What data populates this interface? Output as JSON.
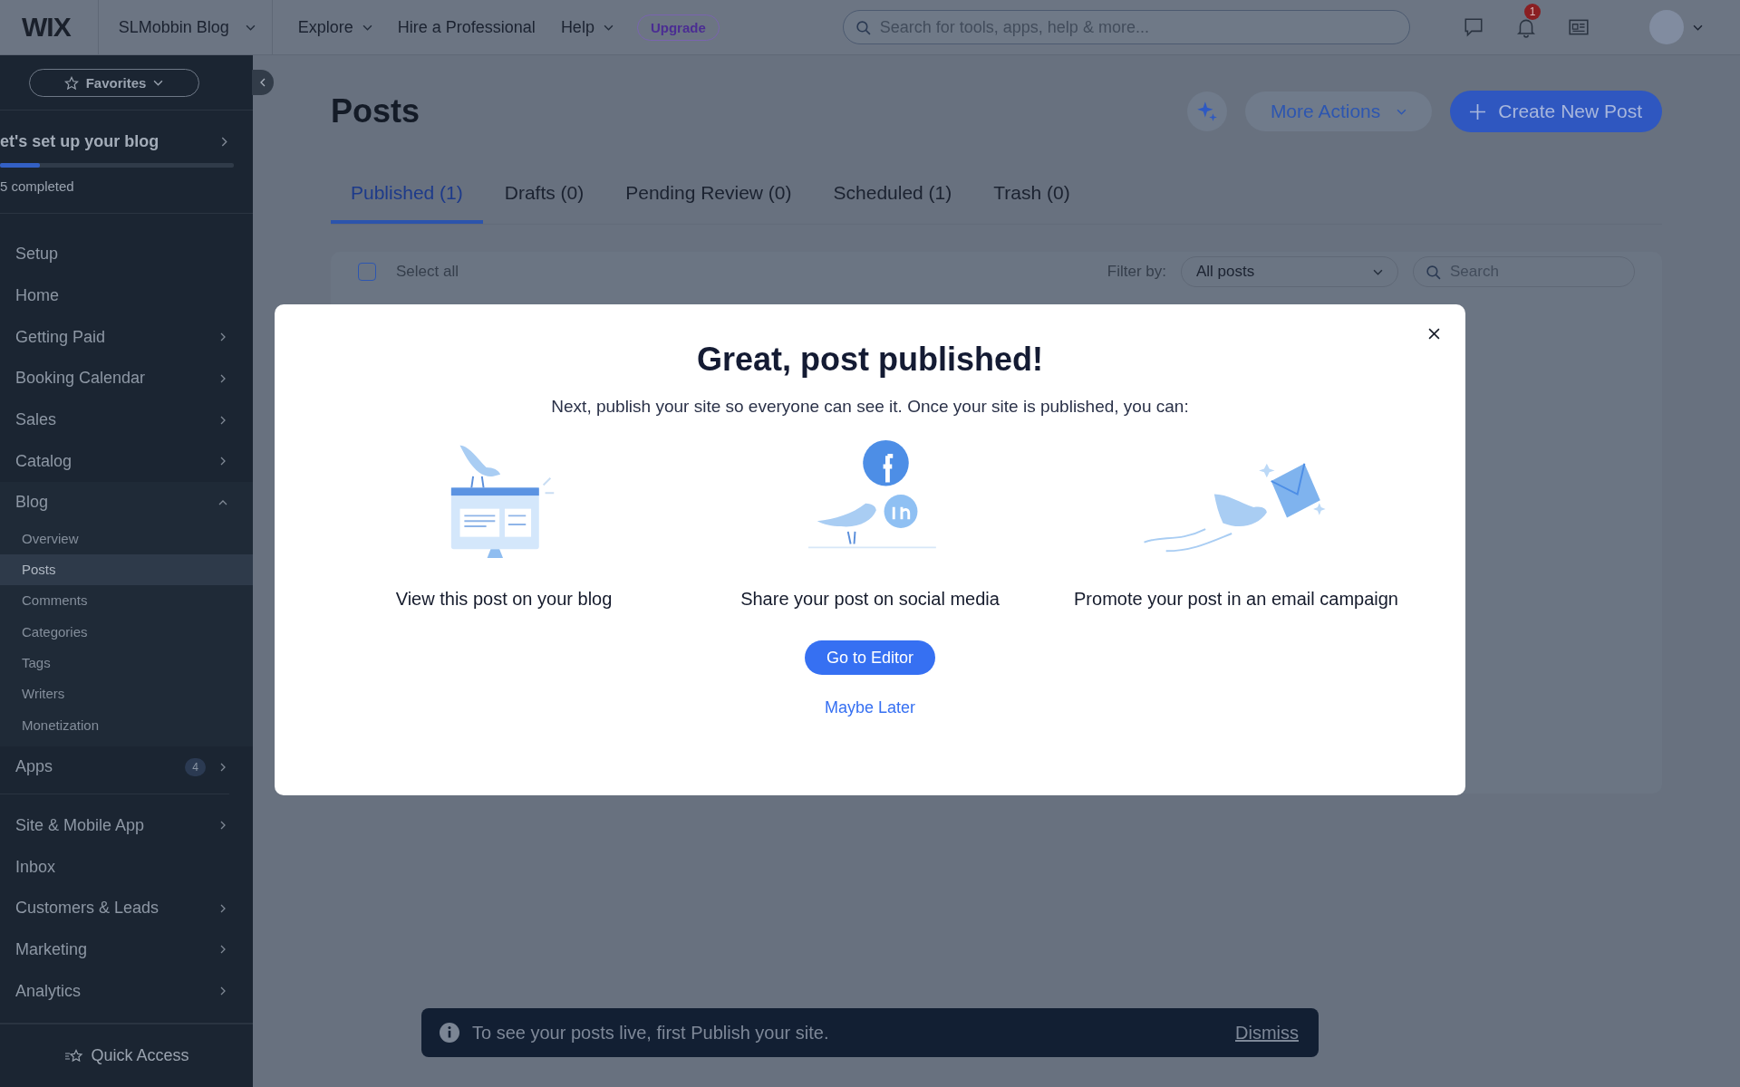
{
  "topbar": {
    "logo": "WIX",
    "site_name": "SLMobbin Blog",
    "nav": [
      {
        "label": "Explore",
        "has_dropdown": true
      },
      {
        "label": "Hire a Professional",
        "has_dropdown": false
      },
      {
        "label": "Help",
        "has_dropdown": true
      }
    ],
    "upgrade": "Upgrade",
    "search": {
      "placeholder": "Search for tools, apps, help & more..."
    },
    "notification_count": "1"
  },
  "sidebar": {
    "favorites": "Favorites",
    "setup": {
      "title": "et's set up your blog",
      "level": 0.17,
      "progress_text": "5 completed"
    },
    "sections": [
      {
        "items": [
          {
            "label": "Setup",
            "has_arrow": false
          },
          {
            "label": "Home",
            "has_arrow": false
          },
          {
            "label": "Getting Paid",
            "has_arrow": true
          },
          {
            "label": "Booking Calendar",
            "has_arrow": true
          },
          {
            "label": "Sales",
            "has_arrow": true
          },
          {
            "label": "Catalog",
            "has_arrow": true
          },
          {
            "label": "Blog",
            "has_arrow": true,
            "expanded": true,
            "children": [
              {
                "label": "Overview",
                "selected": false
              },
              {
                "label": "Posts",
                "selected": true
              },
              {
                "label": "Comments",
                "selected": false
              },
              {
                "label": "Categories",
                "selected": false
              },
              {
                "label": "Tags",
                "selected": false
              },
              {
                "label": "Writers",
                "selected": false
              },
              {
                "label": "Monetization",
                "selected": false
              }
            ]
          },
          {
            "label": "Apps",
            "has_arrow": true,
            "badge": "4"
          }
        ]
      },
      {
        "items": [
          {
            "label": "Site & Mobile App",
            "has_arrow": true
          },
          {
            "label": "Inbox",
            "has_arrow": false
          },
          {
            "label": "Customers & Leads",
            "has_arrow": true
          },
          {
            "label": "Marketing",
            "has_arrow": true
          },
          {
            "label": "Analytics",
            "has_arrow": true
          }
        ]
      }
    ],
    "quick_access": "Quick Access"
  },
  "main": {
    "title": "Posts",
    "more_actions": "More Actions",
    "create": "Create New Post",
    "tabs": [
      {
        "label": "Published (1)",
        "selected": true
      },
      {
        "label": "Drafts (0)",
        "selected": false
      },
      {
        "label": "Pending Review (0)",
        "selected": false
      },
      {
        "label": "Scheduled (1)",
        "selected": false
      },
      {
        "label": "Trash (0)",
        "selected": false
      }
    ],
    "toolbar": {
      "select_all_checked": false,
      "select_all": "Select all",
      "filter_label": "Filter by:",
      "filter_value": "All posts",
      "search_placeholder": "Search"
    }
  },
  "modal": {
    "title": "Great, post published!",
    "subtitle": "Next, publish your site so everyone can see it. Once your site is published, you can:",
    "options": [
      {
        "kind": "blog",
        "caption": "View this post on your blog"
      },
      {
        "kind": "social",
        "caption": "Share your post on social media"
      },
      {
        "kind": "email",
        "caption": "Promote your post in an email campaign"
      }
    ],
    "primary": "Go to Editor",
    "secondary": "Maybe Later"
  },
  "toast": {
    "message": "To see your posts live, first Publish your site.",
    "action": "Dismiss"
  }
}
